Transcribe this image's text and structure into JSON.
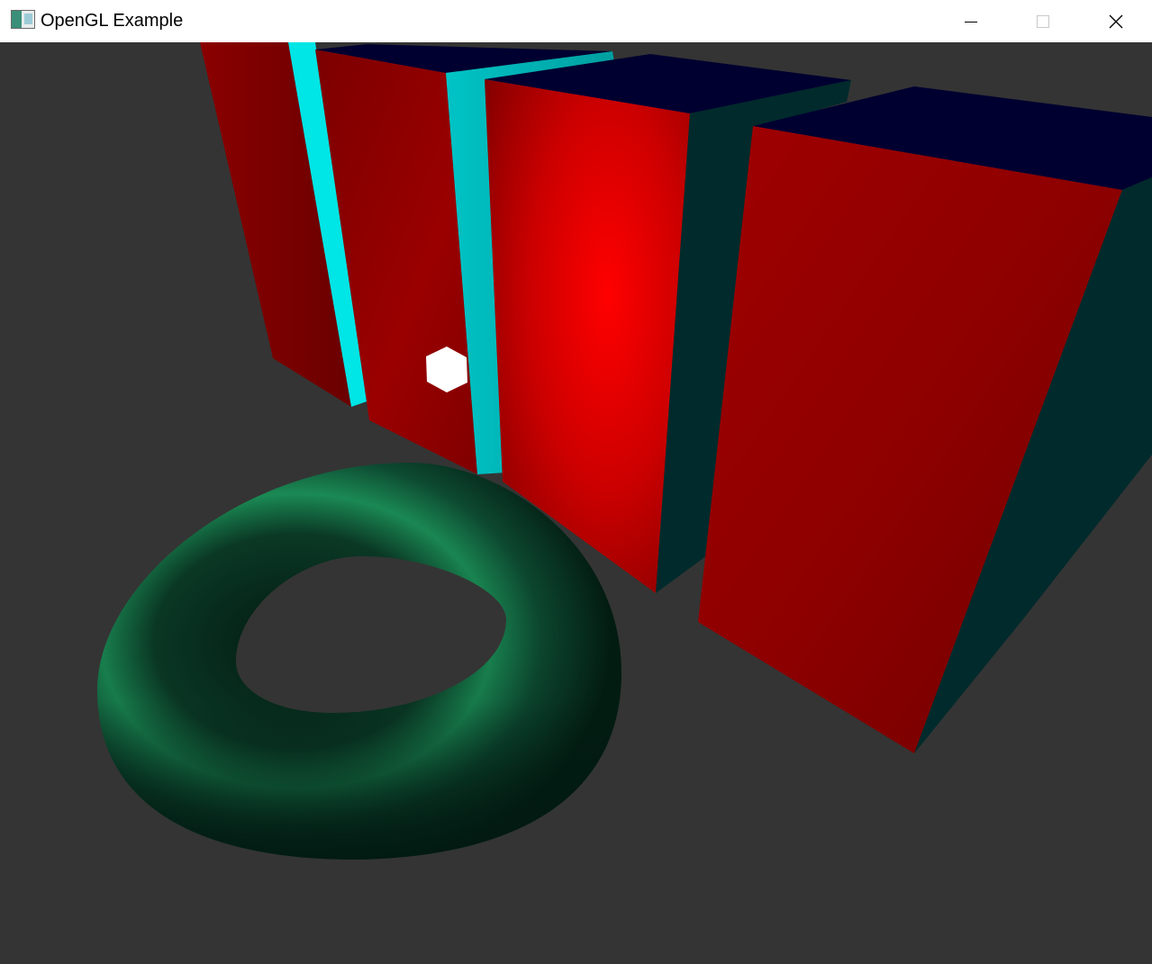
{
  "window": {
    "title": "OpenGL Example",
    "icon": "opengl-app-icon",
    "controls": {
      "minimize": "minimize-icon",
      "maximize": "maximize-icon",
      "close": "close-icon"
    }
  },
  "scene": {
    "background_color": "#343434",
    "colors": {
      "box_front_red": "#ff0000",
      "box_front_dark_red": "#7a0000",
      "box_top_navy": "#000030",
      "box_side_teal": "#002a2c",
      "panel_cyan": "#00e6e6",
      "torus_green": "#1d9a5c",
      "torus_dark": "#021a12",
      "light_marker": "#ffffff"
    }
  }
}
